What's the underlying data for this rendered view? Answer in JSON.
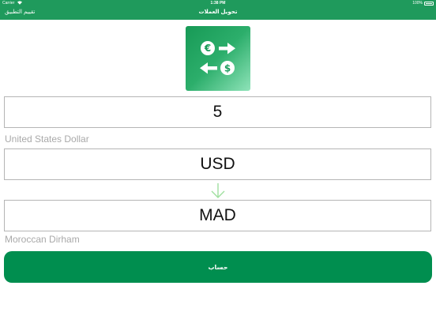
{
  "status_bar": {
    "carrier": "Carrier",
    "time": "1:38 PM",
    "battery": "100%"
  },
  "nav": {
    "title": "تحويل العملات",
    "rate_app": "تقييم التطبيق"
  },
  "logo": {
    "icon": "currency-exchange-icon",
    "colors": [
      "#179a56",
      "#8fe3b9"
    ]
  },
  "converter": {
    "amount": "5",
    "from_currency_name": "United States Dollar",
    "from_currency_code": "USD",
    "arrow_icon": "arrow-down-icon",
    "to_currency_code": "MAD",
    "to_currency_name": "Moroccan Dirham",
    "calculate_label": "حساب"
  },
  "colors": {
    "accent": "#1f9a5c",
    "button": "#008e4f",
    "arrow": "#9fdf9f"
  }
}
